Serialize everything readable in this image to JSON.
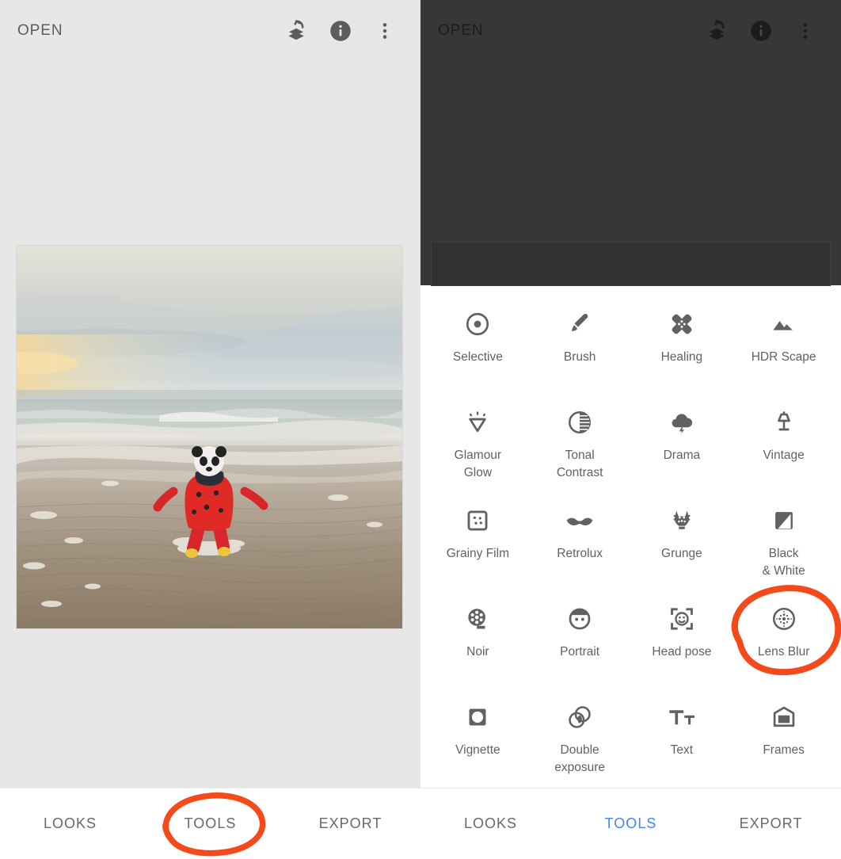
{
  "app": {
    "accent_blue": "#4285f4",
    "annotation_color": "#f4491a",
    "icon_gray": "#616161",
    "left_panel_bg": "#e7e7e7",
    "dark_stage_bg": "#373737"
  },
  "left_screen": {
    "topbar": {
      "title": "OPEN",
      "icons": [
        {
          "name": "undo-stack-icon",
          "label": "Undo / Revert"
        },
        {
          "name": "info-icon",
          "label": "Image details"
        },
        {
          "name": "overflow-menu-icon",
          "label": "More options"
        }
      ]
    },
    "photo": {
      "alt": "Toddler in a red ladybug rain suit and panda hat running on a wet beach at dusk"
    },
    "bottom_nav": {
      "items": [
        {
          "label": "LOOKS",
          "active": false
        },
        {
          "label": "TOOLS",
          "active": false
        },
        {
          "label": "EXPORT",
          "active": false
        }
      ]
    },
    "annotations": [
      {
        "name": "tools-tab-highlight-circle",
        "target": "TOOLS"
      }
    ]
  },
  "right_screen": {
    "topbar": {
      "title": "OPEN",
      "icons": [
        {
          "name": "undo-stack-icon",
          "label": "Undo / Revert"
        },
        {
          "name": "info-icon",
          "label": "Image details"
        },
        {
          "name": "overflow-menu-icon",
          "label": "More options"
        }
      ]
    },
    "tools": [
      {
        "label": "Selective",
        "icon": "selective-icon"
      },
      {
        "label": "Brush",
        "icon": "brush-icon"
      },
      {
        "label": "Healing",
        "icon": "healing-patch-icon"
      },
      {
        "label": "HDR Scape",
        "icon": "mountains-icon"
      },
      {
        "label": "Glamour\nGlow",
        "icon": "diamond-sparkle-icon"
      },
      {
        "label": "Tonal\nContrast",
        "icon": "contrast-circle-icon"
      },
      {
        "label": "Drama",
        "icon": "storm-cloud-icon"
      },
      {
        "label": "Vintage",
        "icon": "table-lamp-icon"
      },
      {
        "label": "Grainy Film",
        "icon": "grain-square-icon"
      },
      {
        "label": "Retrolux",
        "icon": "moustache-icon"
      },
      {
        "label": "Grunge",
        "icon": "grunge-mask-icon"
      },
      {
        "label": "Black\n& White",
        "icon": "black-white-square-icon"
      },
      {
        "label": "Noir",
        "icon": "film-reel-icon"
      },
      {
        "label": "Portrait",
        "icon": "face-portrait-icon"
      },
      {
        "label": "Head pose",
        "icon": "head-pose-bracket-icon"
      },
      {
        "label": "Lens Blur",
        "icon": "lens-blur-dots-icon"
      },
      {
        "label": "Vignette",
        "icon": "vignette-square-icon"
      },
      {
        "label": "Double\nexposure",
        "icon": "double-exposure-icon"
      },
      {
        "label": "Text",
        "icon": "text-tt-icon"
      },
      {
        "label": "Frames",
        "icon": "frame-icon"
      }
    ],
    "bottom_nav": {
      "items": [
        {
          "label": "LOOKS",
          "active": false
        },
        {
          "label": "TOOLS",
          "active": true
        },
        {
          "label": "EXPORT",
          "active": false
        }
      ]
    },
    "annotations": [
      {
        "name": "lens-blur-highlight-circle",
        "target": "Lens Blur"
      }
    ]
  }
}
